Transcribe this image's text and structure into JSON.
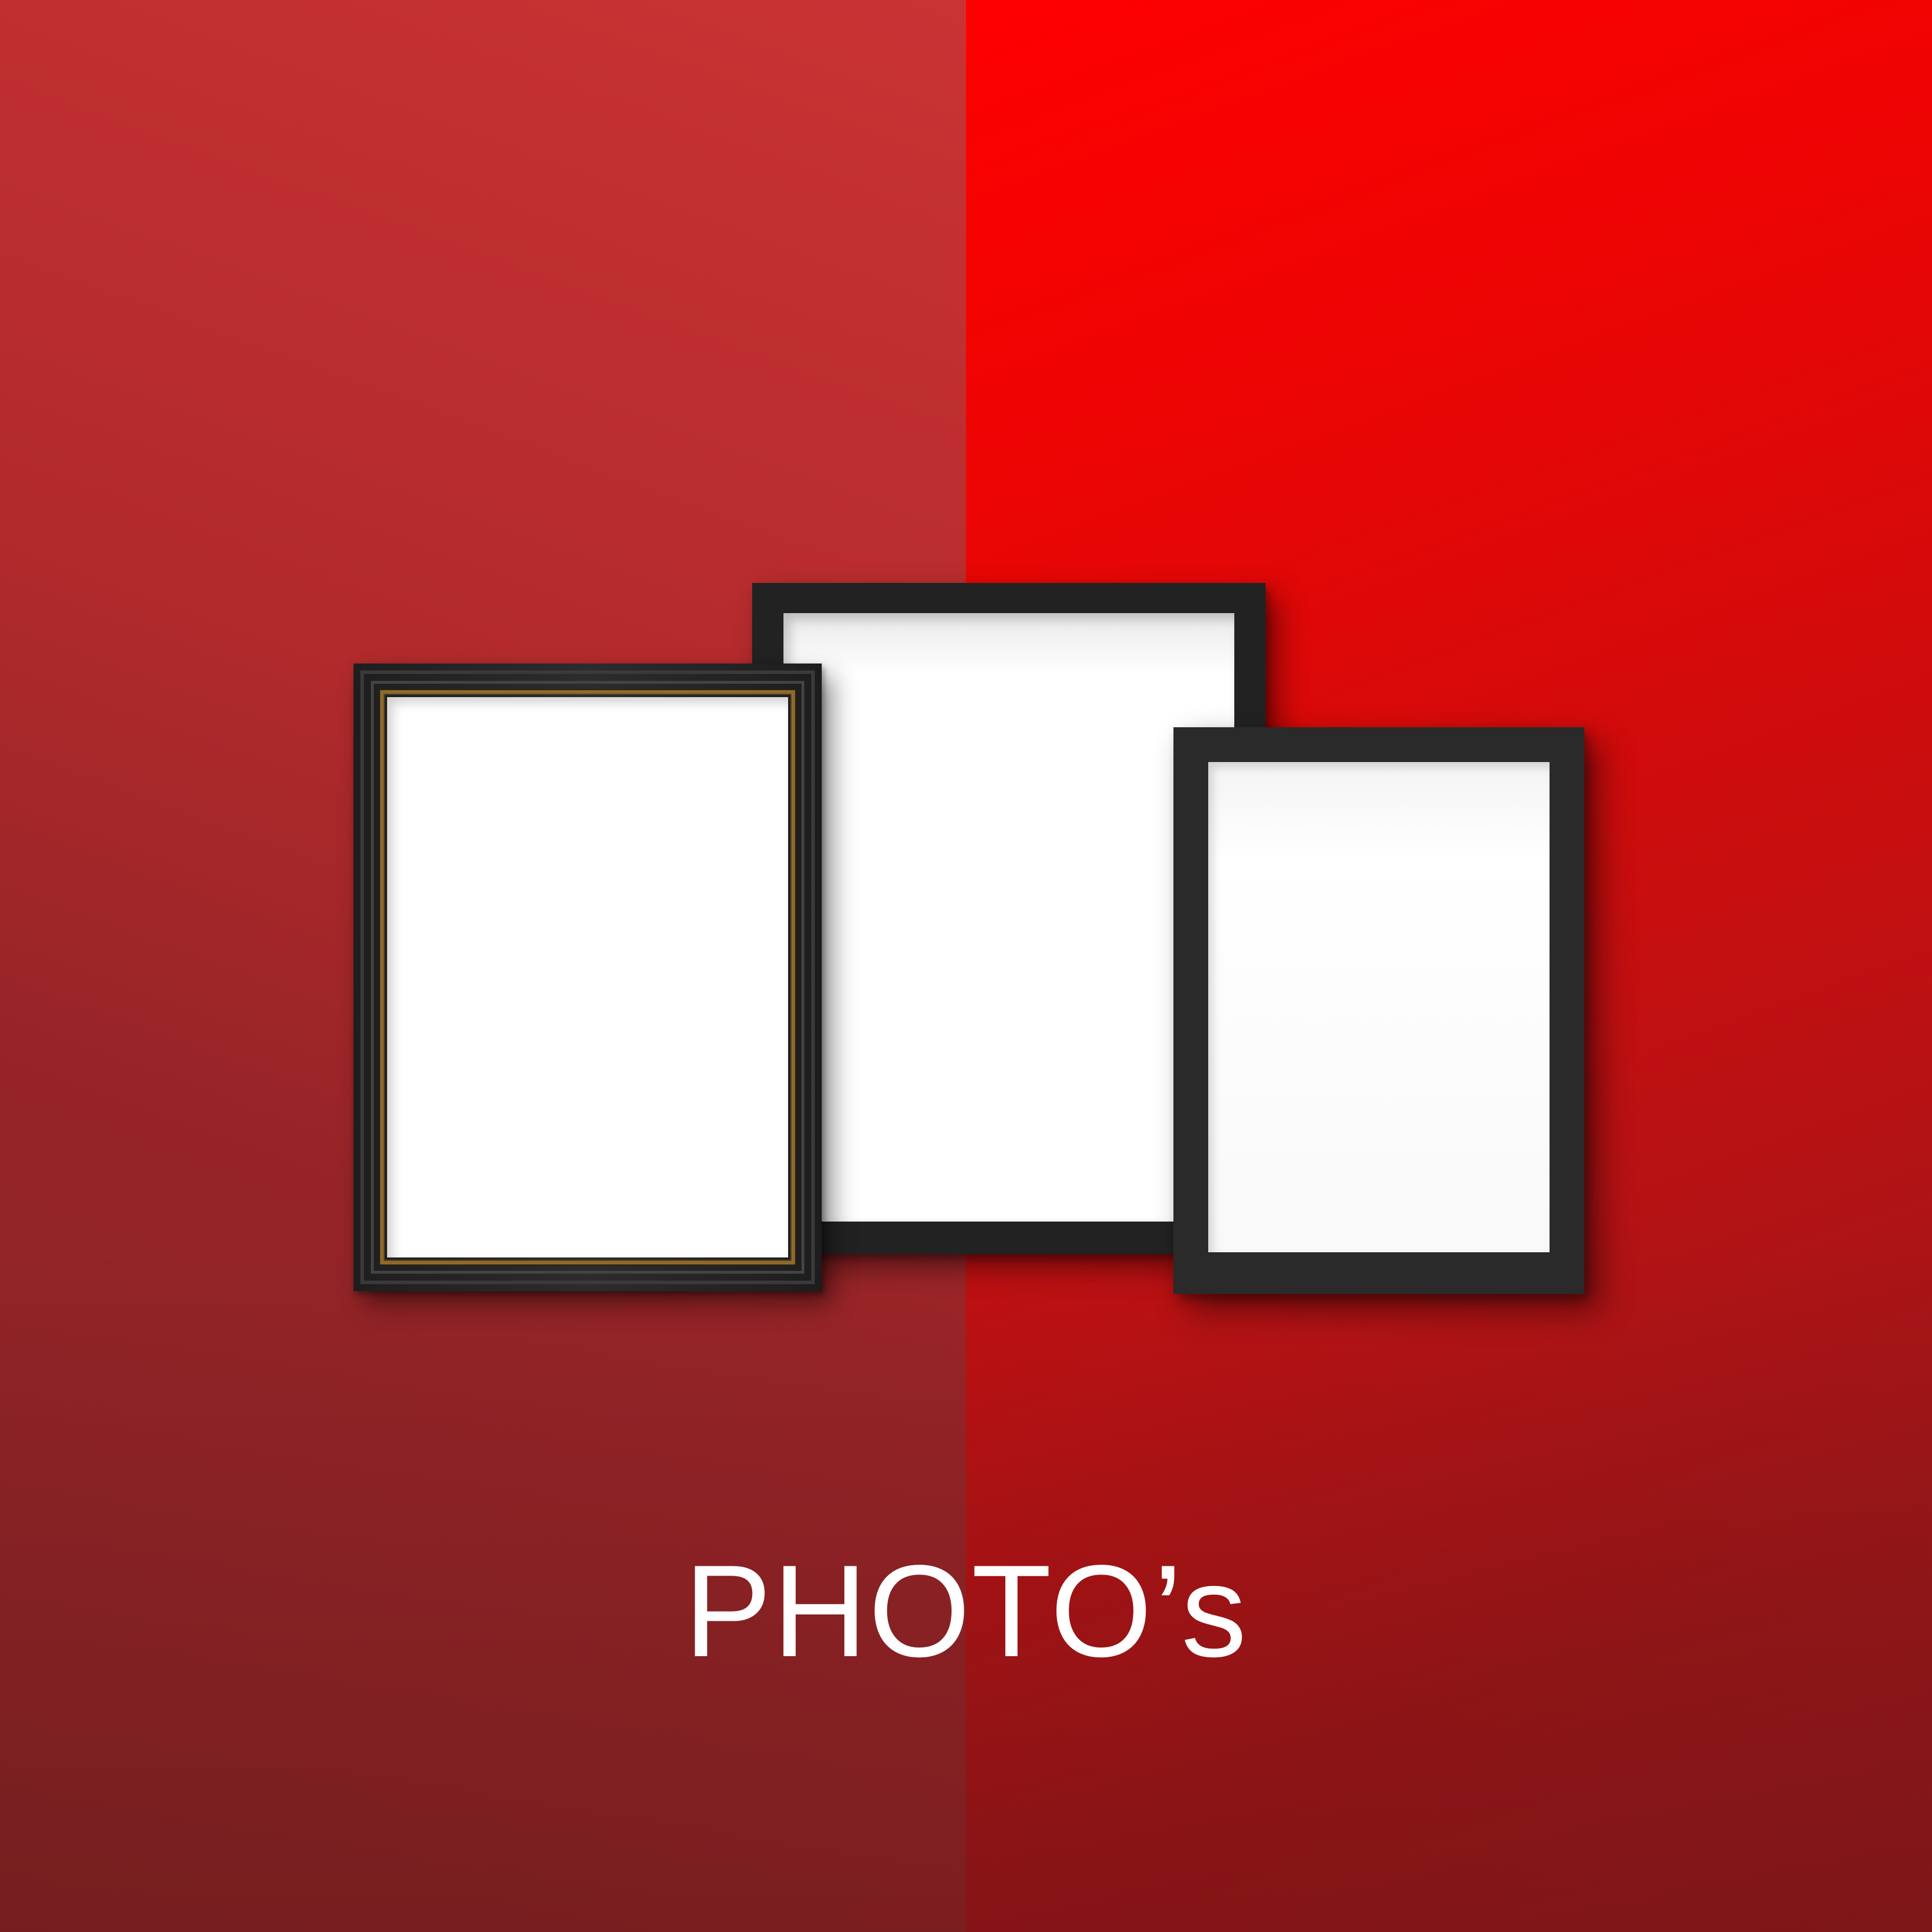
{
  "title": "PHOTO’s",
  "colors": {
    "wall_left": "#c0302f",
    "wall_right": "#ff0000",
    "frame_dark": "#2a2a2a",
    "frame_gold_trim": "#8e6a2a",
    "mat": "#ffffff",
    "title_text": "#ffffff"
  },
  "frames": [
    {
      "name": "ornate-wooden-frame",
      "style": "black wood with gold trim",
      "content": "blank"
    },
    {
      "name": "black-frame-center",
      "style": "black",
      "content": "blank"
    },
    {
      "name": "black-frame-right",
      "style": "black",
      "content": "blank"
    }
  ]
}
